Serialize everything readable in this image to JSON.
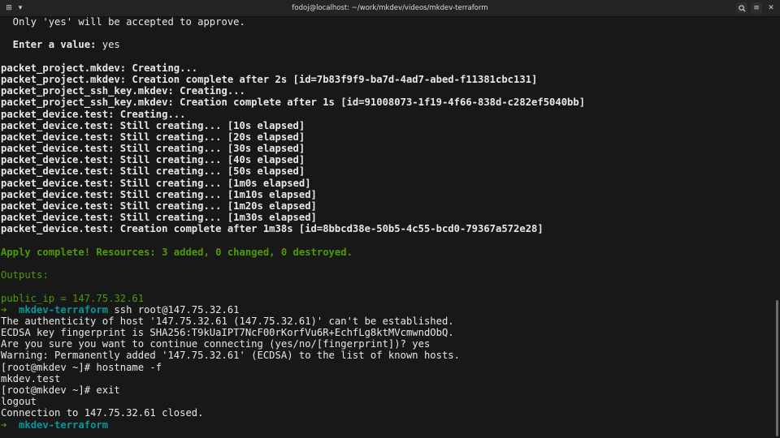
{
  "window": {
    "title": "fodoj@localhost: ~/work/mkdev/videos/mkdev-terraform",
    "icons": [
      "new-tab-icon",
      "dropdown-icon",
      "search-icon",
      "menu-icon",
      "close-icon"
    ]
  },
  "colors": {
    "background": "#181818",
    "text": "#e8e8e8",
    "green": "#4e9a06",
    "cyan": "#06989a"
  },
  "terminal": {
    "lines": [
      {
        "segments": [
          {
            "t": "  Only 'yes' will be accepted to approve.",
            "c": ""
          }
        ]
      },
      {
        "segments": [
          {
            "t": "",
            "c": ""
          }
        ]
      },
      {
        "segments": [
          {
            "t": "  Enter a value: ",
            "c": "bold"
          },
          {
            "t": "yes",
            "c": ""
          }
        ]
      },
      {
        "segments": [
          {
            "t": "",
            "c": ""
          }
        ]
      },
      {
        "segments": [
          {
            "t": "packet_project.mkdev: Creating...",
            "c": "bold"
          }
        ]
      },
      {
        "segments": [
          {
            "t": "packet_project.mkdev: Creation complete after 2s [id=7b83f9f9-ba7d-4ad7-abed-f11381cbc131]",
            "c": "bold"
          }
        ]
      },
      {
        "segments": [
          {
            "t": "packet_project_ssh_key.mkdev: Creating...",
            "c": "bold"
          }
        ]
      },
      {
        "segments": [
          {
            "t": "packet_project_ssh_key.mkdev: Creation complete after 1s [id=91008073-1f19-4f66-838d-c282ef5040bb]",
            "c": "bold"
          }
        ]
      },
      {
        "segments": [
          {
            "t": "packet_device.test: Creating...",
            "c": "bold"
          }
        ]
      },
      {
        "segments": [
          {
            "t": "packet_device.test: Still creating... [10s elapsed]",
            "c": "bold"
          }
        ]
      },
      {
        "segments": [
          {
            "t": "packet_device.test: Still creating... [20s elapsed]",
            "c": "bold"
          }
        ]
      },
      {
        "segments": [
          {
            "t": "packet_device.test: Still creating... [30s elapsed]",
            "c": "bold"
          }
        ]
      },
      {
        "segments": [
          {
            "t": "packet_device.test: Still creating... [40s elapsed]",
            "c": "bold"
          }
        ]
      },
      {
        "segments": [
          {
            "t": "packet_device.test: Still creating... [50s elapsed]",
            "c": "bold"
          }
        ]
      },
      {
        "segments": [
          {
            "t": "packet_device.test: Still creating... [1m0s elapsed]",
            "c": "bold"
          }
        ]
      },
      {
        "segments": [
          {
            "t": "packet_device.test: Still creating... [1m10s elapsed]",
            "c": "bold"
          }
        ]
      },
      {
        "segments": [
          {
            "t": "packet_device.test: Still creating... [1m20s elapsed]",
            "c": "bold"
          }
        ]
      },
      {
        "segments": [
          {
            "t": "packet_device.test: Still creating... [1m30s elapsed]",
            "c": "bold"
          }
        ]
      },
      {
        "segments": [
          {
            "t": "packet_device.test: Creation complete after 1m38s [id=8bbcd38e-50b5-4c55-bcd0-79367a572e28]",
            "c": "bold"
          }
        ]
      },
      {
        "segments": [
          {
            "t": "",
            "c": ""
          }
        ]
      },
      {
        "segments": [
          {
            "t": "Apply complete! Resources: 3 added, 0 changed, 0 destroyed.",
            "c": "green bold"
          }
        ]
      },
      {
        "segments": [
          {
            "t": "",
            "c": ""
          }
        ]
      },
      {
        "segments": [
          {
            "t": "Outputs:",
            "c": "green"
          }
        ]
      },
      {
        "segments": [
          {
            "t": "",
            "c": ""
          }
        ]
      },
      {
        "segments": [
          {
            "t": "public_ip = 147.75.32.61",
            "c": "green"
          }
        ]
      },
      {
        "segments": [
          {
            "t": "➜  ",
            "c": "arrow"
          },
          {
            "t": "mkdev-terraform",
            "c": "cyan"
          },
          {
            "t": " ssh root@147.75.32.61",
            "c": ""
          }
        ]
      },
      {
        "segments": [
          {
            "t": "The authenticity of host '147.75.32.61 (147.75.32.61)' can't be established.",
            "c": ""
          }
        ]
      },
      {
        "segments": [
          {
            "t": "ECDSA key fingerprint is SHA256:T9kUaIPT7NcF00rKorfVu6R+EchfLg8ktMVcmwndObQ.",
            "c": ""
          }
        ]
      },
      {
        "segments": [
          {
            "t": "Are you sure you want to continue connecting (yes/no/[fingerprint])? yes",
            "c": ""
          }
        ]
      },
      {
        "segments": [
          {
            "t": "Warning: Permanently added '147.75.32.61' (ECDSA) to the list of known hosts.",
            "c": ""
          }
        ]
      },
      {
        "segments": [
          {
            "t": "[root@mkdev ~]# hostname -f",
            "c": ""
          }
        ]
      },
      {
        "segments": [
          {
            "t": "mkdev.test",
            "c": ""
          }
        ]
      },
      {
        "segments": [
          {
            "t": "[root@mkdev ~]# exit",
            "c": ""
          }
        ]
      },
      {
        "segments": [
          {
            "t": "logout",
            "c": ""
          }
        ]
      },
      {
        "segments": [
          {
            "t": "Connection to 147.75.32.61 closed.",
            "c": ""
          }
        ]
      },
      {
        "segments": [
          {
            "t": "➜  ",
            "c": "arrow"
          },
          {
            "t": "mkdev-terraform",
            "c": "cyan"
          }
        ]
      }
    ]
  }
}
